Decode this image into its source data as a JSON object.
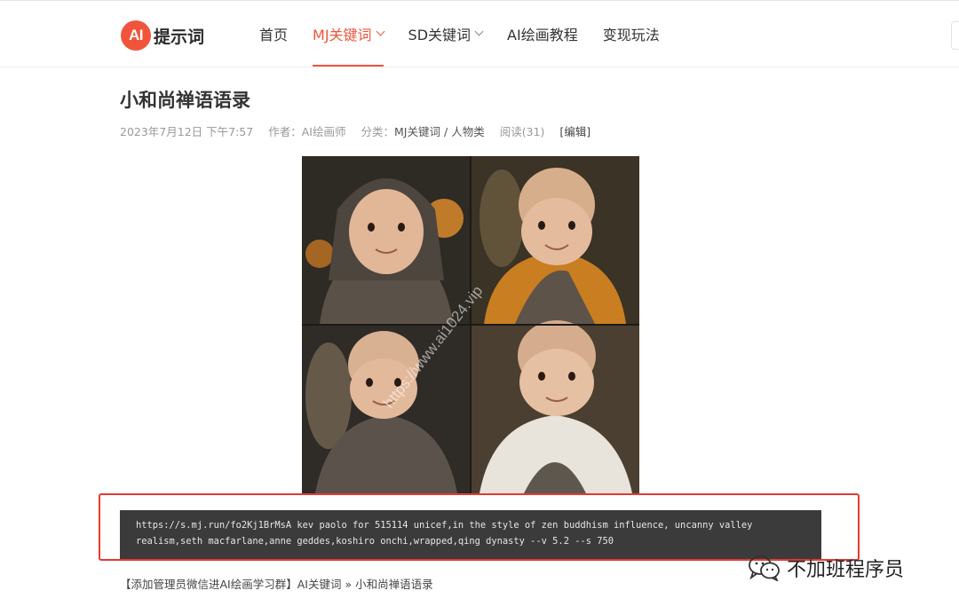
{
  "brand": {
    "badge": "AI",
    "name": "提示词",
    "accent": "#f0553c"
  },
  "nav": [
    {
      "label": "首页",
      "active": false,
      "dropdown": false
    },
    {
      "label": "MJ关键词",
      "active": true,
      "dropdown": true
    },
    {
      "label": "SD关键词",
      "active": false,
      "dropdown": true
    },
    {
      "label": "AI绘画教程",
      "active": false,
      "dropdown": false
    },
    {
      "label": "变现玩法",
      "active": false,
      "dropdown": false
    }
  ],
  "article": {
    "title": "小和尚禅语语录",
    "date": "2023年7月12日 下午7:57",
    "author_prefix": "作者：",
    "author": "AI绘画师",
    "category_prefix": "分类：",
    "category_main": "MJ关键词",
    "category_separator": "/",
    "category_sub": "人物类",
    "views": "阅读(31)",
    "edit": "[编辑]"
  },
  "image": {
    "description": "2x2 grid of baby monks in robes",
    "watermark_overlay": "https://www.ai1024.vip"
  },
  "prompt": {
    "line1": "https://s.mj.run/fo2Kj1BrMsA kev paolo for 515114 unicef,in the style of zen buddhism influence, uncanny valley",
    "line2": "realism,seth macfarlane,anne geddes,koshiro onchi,wrapped,qing dynasty --v 5.2 --s 750"
  },
  "breadcrumb": {
    "group": "【添加管理员微信进AI绘画学习群】",
    "category": "AI关键词",
    "separator": "»",
    "current": "小和尚禅语语录"
  },
  "source_watermark": {
    "icon": "wechat-icon",
    "text": "不加班程序员"
  },
  "colors": {
    "highlight_border": "#e53935",
    "code_bg": "#3b3b3b"
  }
}
